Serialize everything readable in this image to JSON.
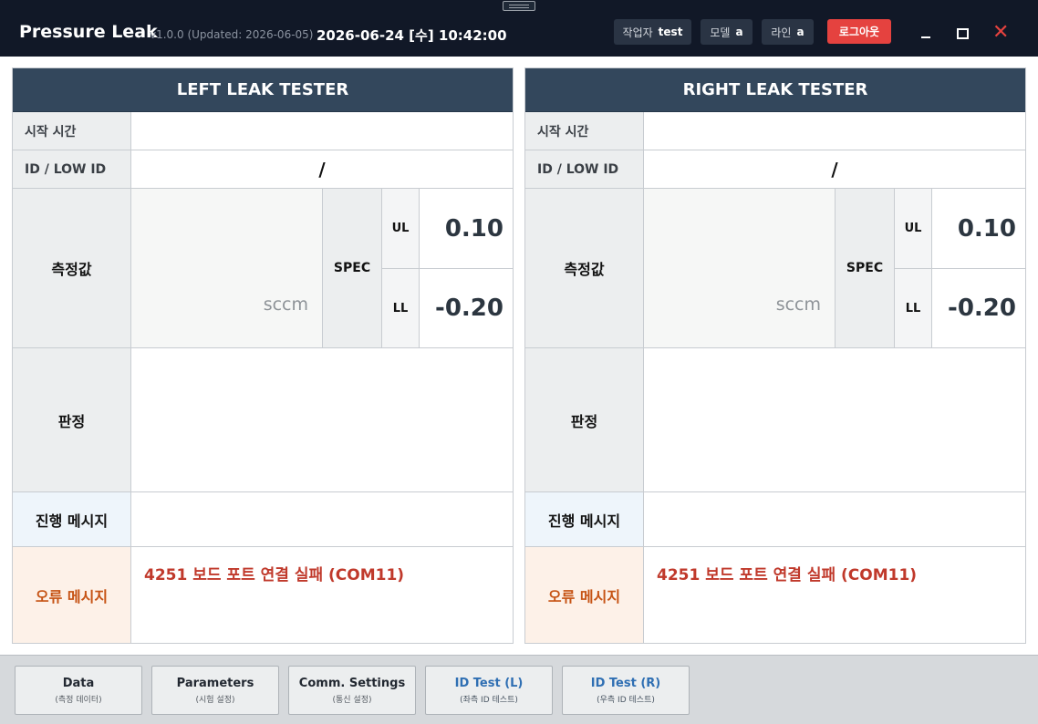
{
  "window": {
    "title": "Pressure Leak",
    "version": "v1.0.0 (Updated: 2026-06-05)",
    "datetime": "2026-06-24 [수] 10:42:00",
    "operator_label": "작업자",
    "operator_value": "test",
    "model_label": "모델",
    "model_value": "a",
    "line_label": "라인",
    "line_value": "a",
    "logout_label": "로그아웃",
    "minimize_icon": "minimize-icon",
    "maximize_icon": "maximize-icon",
    "close_icon": "close-icon",
    "close_glyph": "✕",
    "accent_color": "#e5423f",
    "header_color": "#33475c"
  },
  "left": {
    "header": "LEFT LEAK TESTER",
    "start_time_label": "시작 시간",
    "start_time_value": "",
    "id_label": "ID / LOW ID",
    "id_value": "/",
    "measure_label": "측정값",
    "measure_unit": "sccm",
    "spec_label": "SPEC",
    "ul_label": "UL",
    "ul_value": "0.10",
    "ll_label": "LL",
    "ll_value": "-0.20",
    "judge_label": "판정",
    "judge_value": "",
    "progress_label": "진행 메시지",
    "progress_value": "",
    "error_label": "오류 메시지",
    "error_value": "4251 보드 포트 연결 실패 (COM11)"
  },
  "right": {
    "header": "RIGHT LEAK TESTER",
    "start_time_label": "시작 시간",
    "start_time_value": "",
    "id_label": "ID / LOW ID",
    "id_value": "/",
    "measure_label": "측정값",
    "measure_unit": "sccm",
    "spec_label": "SPEC",
    "ul_label": "UL",
    "ul_value": "0.10",
    "ll_label": "LL",
    "ll_value": "-0.20",
    "judge_label": "판정",
    "judge_value": "",
    "progress_label": "진행 메시지",
    "progress_value": "",
    "error_label": "오류 메시지",
    "error_value": "4251 보드 포트 연결 실패 (COM11)"
  },
  "nav": [
    {
      "label": "Data",
      "sub": "(측정 데이터)"
    },
    {
      "label": "Parameters",
      "sub": "(시험 설정)"
    },
    {
      "label": "Comm. Settings",
      "sub": "(통신 설정)"
    },
    {
      "label": "ID Test (L)",
      "sub": "(좌측 ID 테스트)"
    },
    {
      "label": "ID Test (R)",
      "sub": "(우측 ID 테스트)"
    }
  ]
}
